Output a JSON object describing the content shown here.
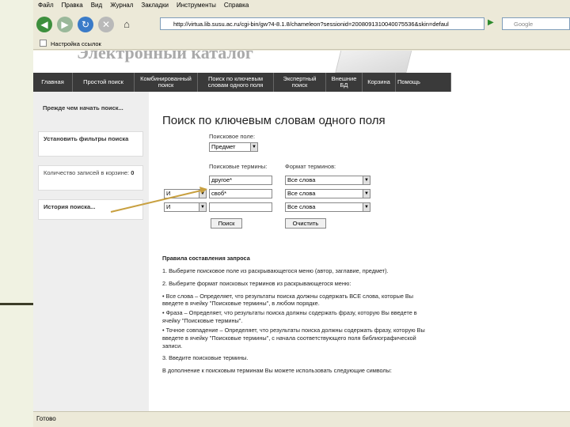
{
  "menu": [
    "Файл",
    "Правка",
    "Вид",
    "Журнал",
    "Закладки",
    "Инструменты",
    "Справка"
  ],
  "address": {
    "url": "http://virtua.lib.susu.ac.ru/cgi-bin/gw?4-8.1.8/chameleon?sessionid=2008091310040075536&skin=defaul"
  },
  "search": {
    "placeholder": "Google"
  },
  "bookmarks": {
    "item": "Настройка ссылок"
  },
  "ghost_title": "Электронный каталог",
  "nav": [
    "Главная",
    "Простой поиск",
    "Комбинированный поиск",
    "Поиск по ключевым словам одного поля",
    "Экспертный поиск",
    "Внешние БД",
    "Корзина",
    "Помощь"
  ],
  "sidebar": {
    "before_search": "Прежде чем начать поиск...",
    "set_filters": "Установить фильтры поиска",
    "cart_prefix": "Количество записей в корзине:",
    "cart_count": "0",
    "history": "История поиска..."
  },
  "form": {
    "heading": "Поиск по ключевым словам одного поля",
    "search_field_label": "Поисковое поле:",
    "search_field_value": "Предмет",
    "terms_label": "Поисковые термины:",
    "format_label": "Формат терминов:",
    "rows": [
      {
        "op": "",
        "term": "другое*",
        "format": "Все слова"
      },
      {
        "op": "И",
        "term": "своб*",
        "format": "Все слова"
      },
      {
        "op": "И",
        "term": "",
        "format": "Все слова"
      }
    ],
    "search_button": "Поиск",
    "clear_button": "Очистить"
  },
  "rules": {
    "title": "Правила составления запроса",
    "items": [
      "1. Выберите поисковое поле из раскрывающегося меню (автор, заглавие, предмет).",
      "2. Выберите формат поисковых терминов из раскрывающегося меню:",
      "• Все слова – Определяет, что результаты поиска должны содержать ВСЕ слова, которые Вы введете в ячейку \"Поисковые термины\", в любом порядке.",
      "• Фраза – Определяет, что результаты поиска должны содержать фразу, которую Вы введете в ячейку \"Поисковые термины\".",
      "• Точное совпадение – Определяет, что результаты поиска должны содержать фразу, которую Вы введете в ячейку \"Поисковые термины\", с начала соответствующего поля библиографической записи.",
      "3. Введите поисковые термины.",
      "В дополнение к поисковым терминам Вы можете использовать следующие символы:"
    ]
  },
  "status": "Готово"
}
